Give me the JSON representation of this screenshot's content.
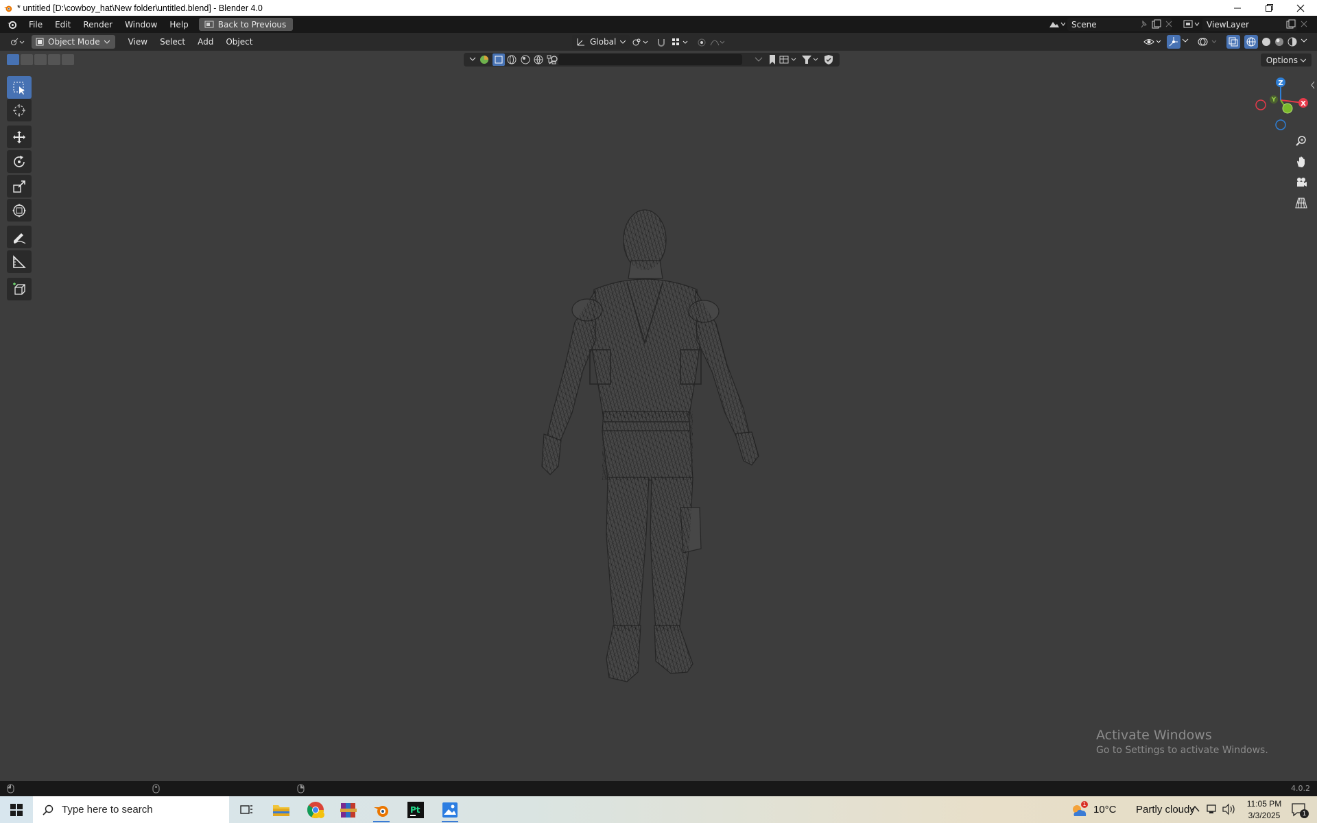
{
  "window": {
    "title": "* untitled [D:\\cowboy_hat\\New folder\\untitled.blend] - Blender 4.0",
    "controls": [
      "minimize",
      "restore",
      "close"
    ]
  },
  "menubar": {
    "items": [
      "File",
      "Edit",
      "Render",
      "Window",
      "Help"
    ],
    "back_button": "Back to Previous",
    "scene": "Scene",
    "view_layer": "ViewLayer"
  },
  "viewport_header": {
    "mode": "Object Mode",
    "menus": [
      "View",
      "Select",
      "Add",
      "Object"
    ],
    "orientation": "Global",
    "options": "Options"
  },
  "toolbar": {
    "tools": [
      "select-box",
      "cursor",
      "move",
      "rotate",
      "scale",
      "transform",
      "annotate",
      "measure",
      "add-cube"
    ],
    "active_tool": "select-box"
  },
  "gizmo": {
    "axes": {
      "x": "X",
      "y": "Y",
      "z": "Z"
    },
    "colors": {
      "x": "#e63a4a",
      "y": "#7ab82b",
      "z": "#2f7fd6"
    }
  },
  "watermark": {
    "title": "Activate Windows",
    "subtitle": "Go to Settings to activate Windows."
  },
  "statusbar": {
    "version": "4.0.2"
  },
  "taskbar": {
    "search_placeholder": "Type here to search",
    "weather": {
      "temperature": "10°C",
      "condition": "Partly cloudy",
      "badge": "1"
    },
    "clock": {
      "time": "11:05 PM",
      "date": "3/3/2025"
    },
    "notification_count": "1"
  },
  "colors": {
    "viewport_bg": "#3d3d3d",
    "accent": "#4772b3"
  }
}
